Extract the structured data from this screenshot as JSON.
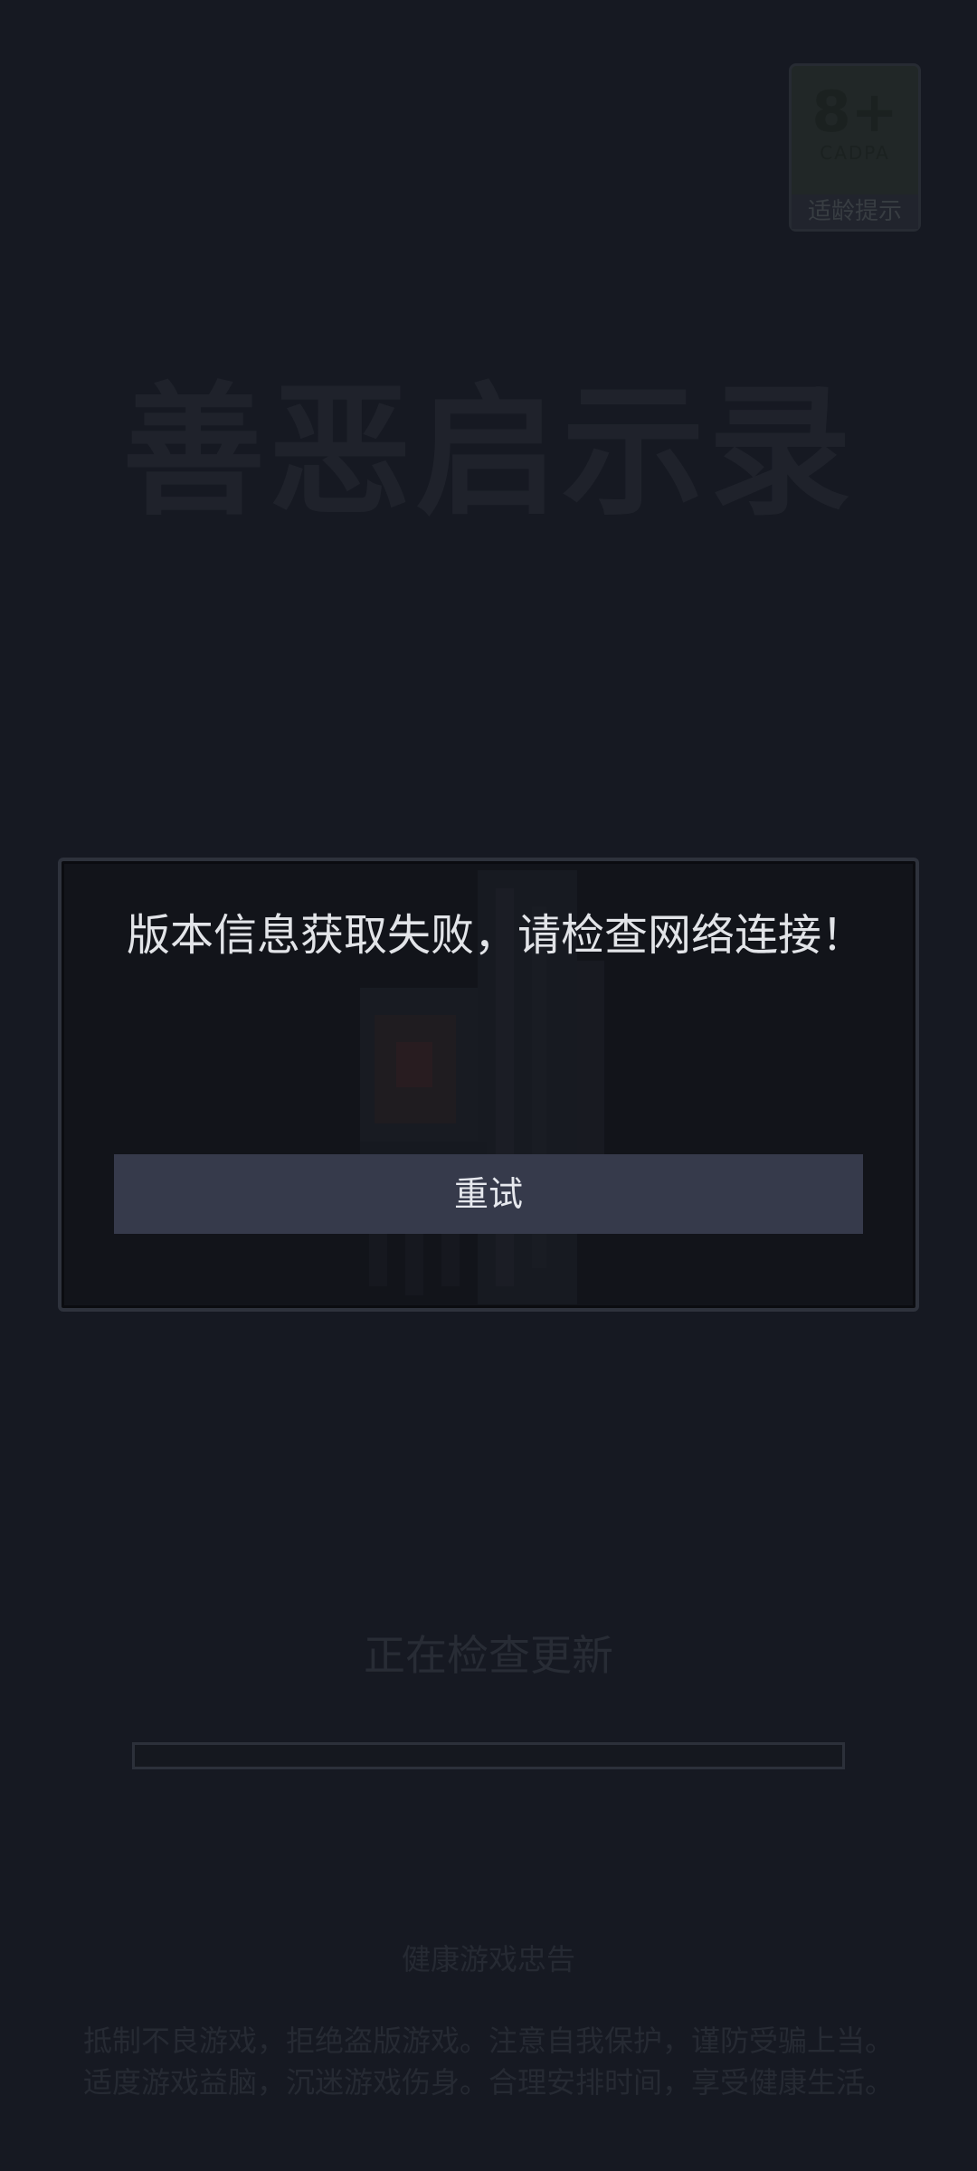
{
  "age_rating": {
    "value": "8+",
    "organization": "CADPA",
    "tip": "适龄提示"
  },
  "game": {
    "title": "善恶启示录"
  },
  "dialog": {
    "message": "版本信息获取失败，请检查网络连接！",
    "retry_label": "重试"
  },
  "update": {
    "status_text": "正在检查更新",
    "progress": 0
  },
  "health_notice": {
    "title": "健康游戏忠告",
    "line1": "抵制不良游戏，拒绝盗版游戏。注意自我保护，谨防受骗上当。",
    "line2": "适度游戏益脑，沉迷游戏伤身。合理安排时间，享受健康生活。"
  },
  "colors": {
    "background": "#161922",
    "dialog_background": "#12141a",
    "button_background": "#363a4b",
    "message_text": "#e2e4e8"
  }
}
